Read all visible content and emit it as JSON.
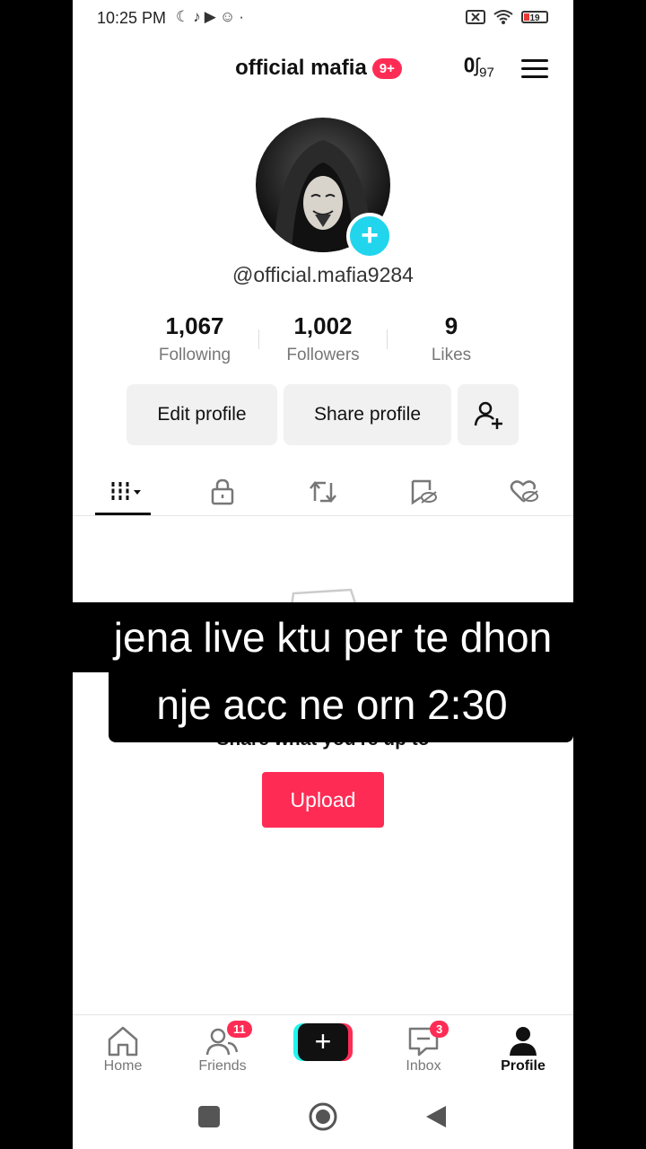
{
  "status_bar": {
    "time": "10:25 PM",
    "left_icons": [
      "moon-icon",
      "tiktok-icon",
      "youtube-icon",
      "snapchat-icon",
      "dot-icon"
    ],
    "right_icons": [
      "no-sim-icon",
      "wifi-icon",
      "battery-icon"
    ],
    "battery": "19"
  },
  "header": {
    "title": "official mafia",
    "badge": "9+",
    "footsteps_count": "97"
  },
  "profile": {
    "handle": "@official.mafia9284",
    "stats": [
      {
        "value": "1,067",
        "label": "Following"
      },
      {
        "value": "1,002",
        "label": "Followers"
      },
      {
        "value": "9",
        "label": "Likes"
      }
    ],
    "edit_label": "Edit profile",
    "share_label": "Share profile"
  },
  "tabs": [
    "videos-grid-icon",
    "lock-icon",
    "repost-icon",
    "favorites-hidden-icon",
    "liked-hidden-icon"
  ],
  "content": {
    "empty_text": "Share what you're up to",
    "upload_label": "Upload"
  },
  "caption": {
    "line1": "jena live ktu per te dhon",
    "line2": "nje acc ne orn 2:30"
  },
  "bottom_nav": {
    "home": "Home",
    "friends": "Friends",
    "friends_badge": "11",
    "inbox": "Inbox",
    "inbox_badge": "3",
    "profile": "Profile"
  },
  "colors": {
    "accent": "#fe2c55",
    "teal": "#20d5ec",
    "button_bg": "#f1f1f2"
  }
}
